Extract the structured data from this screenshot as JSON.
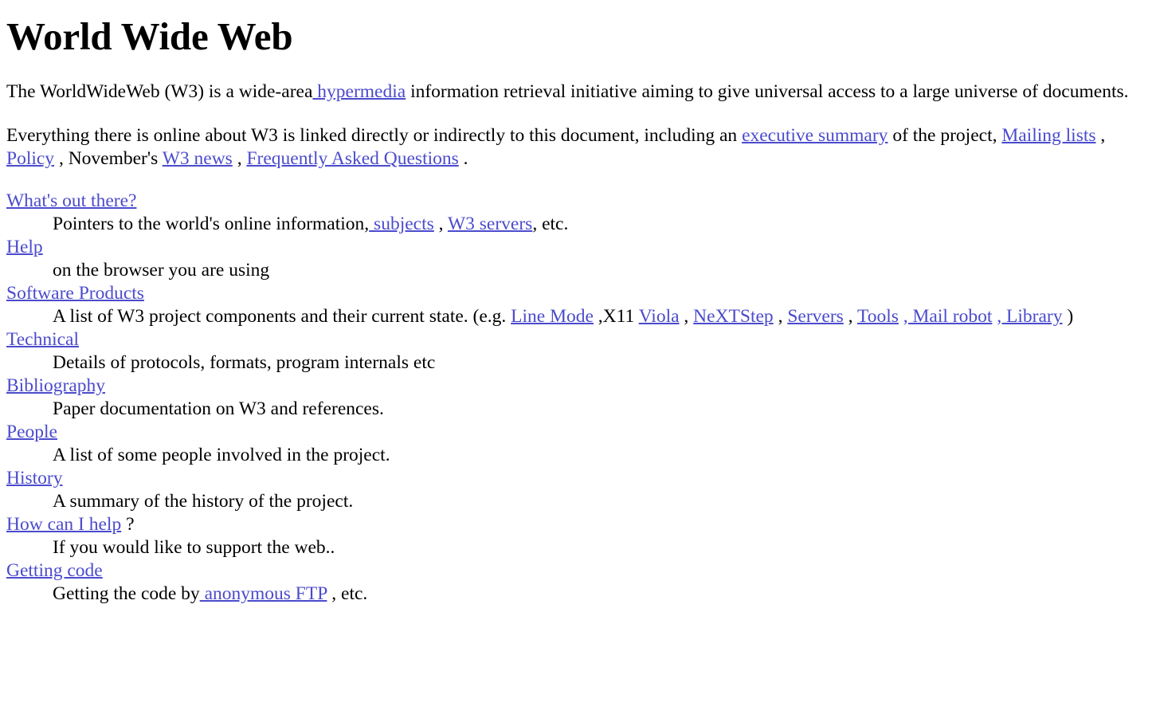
{
  "document": {
    "title": "World Wide Web",
    "link_color": "#4b4bcd",
    "text_color": "#000000",
    "background_color": "#ffffff"
  },
  "intro": {
    "p1_before": "The WorldWideWeb (W3) is a wide-area",
    "p1_link_hypermedia": " hypermedia",
    "p1_after": " information retrieval initiative aiming to give universal access to a large universe of documents.",
    "p2_a": "Everything there is online about W3 is linked directly or indirectly to this document, including an ",
    "p2_link_exec": "executive summary",
    "p2_b": " of the project, ",
    "p2_link_mailing": "Mailing lists",
    "p2_c": " , ",
    "p2_link_policy": "Policy",
    "p2_d": " , November's ",
    "p2_link_w3news": "W3 news",
    "p2_e": " , ",
    "p2_link_faq": "Frequently Asked Questions",
    "p2_f": " ."
  },
  "directory": [
    {
      "term": "What's out there?",
      "def_a": "Pointers to the world's online information,",
      "def_link_1": " subjects",
      "def_b": " , ",
      "def_link_2": "W3 servers",
      "def_c": ", etc."
    },
    {
      "term": "Help",
      "def_a": "on the browser you are using"
    },
    {
      "term": "Software Products",
      "def_a": "A list of W3 project components and their current state. (e.g. ",
      "def_link_1": "Line Mode",
      "def_b": " ,X11 ",
      "def_link_2": "Viola",
      "def_c": " , ",
      "def_link_3": "NeXTStep",
      "def_d": " , ",
      "def_link_4": "Servers",
      "def_e": " , ",
      "def_link_5": "Tools",
      "def_f": " ",
      "def_link_6": ", Mail robot",
      "def_g": " ",
      "def_link_7": ", Library",
      "def_h": " )"
    },
    {
      "term": "Technical",
      "def_a": "Details of protocols, formats, program internals etc"
    },
    {
      "term": "Bibliography",
      "def_a": "Paper documentation on W3 and references."
    },
    {
      "term": "People",
      "def_a": "A list of some people involved in the project."
    },
    {
      "term": "History",
      "def_a": "A summary of the history of the project."
    },
    {
      "term": "How can I help",
      "term_suffix": " ?",
      "def_a": "If you would like to support the web.."
    },
    {
      "term": "Getting code",
      "def_a": "Getting the code by",
      "def_link_1": " anonymous FTP",
      "def_b": " , etc."
    }
  ]
}
